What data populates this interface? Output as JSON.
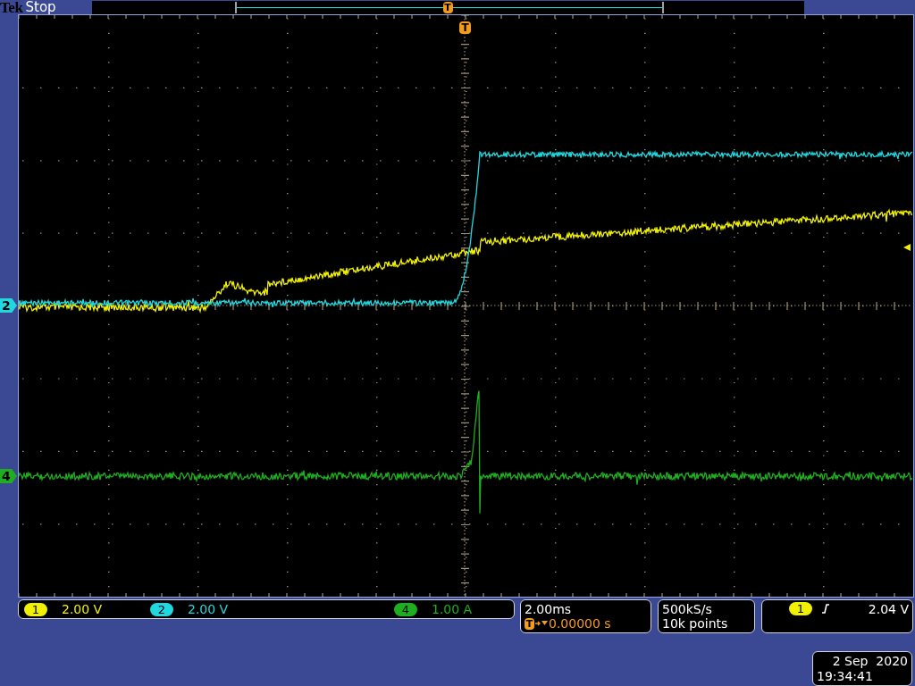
{
  "status_bar": {
    "brand": "Tek",
    "acquisition_state": "Stop",
    "record_trigger_marker": "T"
  },
  "graticule": {
    "trigger_position_marker": "T"
  },
  "trace_markers": [
    {
      "label": "2",
      "color": "#22d8e0"
    },
    {
      "label": "4",
      "color": "#1fae1f"
    }
  ],
  "channels": [
    {
      "number": "1",
      "scale": "2.00 V",
      "color": "#f0f000"
    },
    {
      "number": "2",
      "scale": "2.00 V",
      "color": "#22d8e0"
    },
    {
      "number": "4",
      "scale": "1.00 A",
      "color": "#1fae1f"
    }
  ],
  "horizontal": {
    "scale": "2.00ms",
    "trigger_icon": "T",
    "delay": "0.00000 s"
  },
  "acquisition": {
    "sample_rate": "500kS/s",
    "record_length": "10k points"
  },
  "trigger": {
    "source": {
      "label": "1",
      "color": "#f0f000"
    },
    "level": "2.04 V"
  },
  "clock": {
    "date": "2 Sep  2020",
    "time": "19:34:41"
  }
}
